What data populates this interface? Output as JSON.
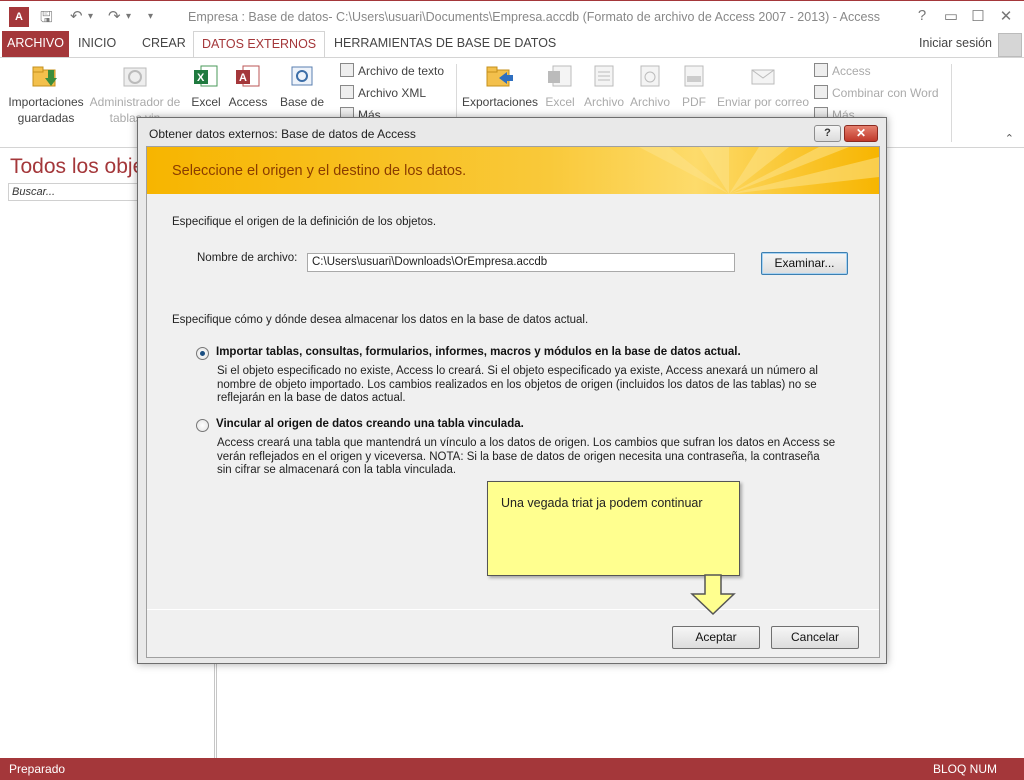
{
  "window": {
    "title": "Empresa : Base de datos- C:\\Users\\usuari\\Documents\\Empresa.accdb (Formato de archivo de Access 2007 - 2013) - Access",
    "app_icon_text": "A",
    "controls": {
      "help": "?",
      "minimize": "—",
      "maximize": "☐",
      "close": "✕"
    }
  },
  "quick_access": {
    "save": "🖫",
    "undo": "↶",
    "undo_drop": "▾",
    "redo": "↷",
    "redo_drop": "▾",
    "customize": "▾"
  },
  "tabs": [
    "ARCHIVO",
    "INICIO",
    "CREAR",
    "DATOS EXTERNOS",
    "HERRAMIENTAS DE BASE DE DATOS"
  ],
  "signin_label": "Iniciar sesión",
  "ribbon": {
    "import_group": {
      "saved_imports": [
        "Importaciones",
        "guardadas"
      ],
      "linked_table_manager": [
        "Administrador de",
        "tablas vin"
      ],
      "excel": "Excel",
      "access": "Access",
      "database": "Base de",
      "text_file": "Archivo de texto",
      "xml_file": "Archivo XML",
      "more": "Más"
    },
    "export_group": {
      "exports": "Exportaciones",
      "excel": "Excel",
      "file1": "Archivo",
      "file2": "Archivo",
      "pdf": "PDF",
      "email": "Enviar por correo",
      "access": "Access",
      "merge_word": "Combinar con Word",
      "more": "Más"
    },
    "collapse_icon": "⌃"
  },
  "nav_pane": {
    "title": "Todos los obje",
    "search_placeholder": "Buscar..."
  },
  "status_bar": {
    "left": "Preparado",
    "right": "BLOQ NUM"
  },
  "dialog": {
    "title": "Obtener datos externos: Base de datos de Access",
    "help_label": "?",
    "close_label": "✕",
    "banner": "Seleccione el origen y el destino de los datos.",
    "source_prompt": "Especifique el origen de la definición de los objetos.",
    "file_label": "Nombre de archivo:",
    "file_value": "C:\\Users\\usuari\\Downloads\\OrEmpresa.accdb",
    "browse_label": "Examinar...",
    "dest_prompt": "Especifique cómo y dónde desea almacenar los datos en la base de datos actual.",
    "options": [
      {
        "title": "Importar tablas, consultas, formularios, informes, macros y módulos en la base de datos actual.",
        "desc": "Si el objeto especificado no existe, Access lo creará. Si el objeto especificado ya existe, Access anexará un número al nombre de objeto importado. Los cambios realizados en los objetos de origen (incluidos los datos de las tablas) no se reflejarán en la base de datos actual.",
        "selected": true
      },
      {
        "title": "Vincular al origen de datos creando una tabla vinculada.",
        "desc": "Access creará una tabla que mantendrá un vínculo a los datos de origen. Los cambios que sufran los datos en Access se verán reflejados en el origen y viceversa. NOTA: Si la base de datos de origen necesita una contraseña, la contraseña sin cifrar se almacenará con la tabla vinculada.",
        "selected": false
      }
    ],
    "ok_label": "Aceptar",
    "cancel_label": "Cancelar"
  },
  "callout": {
    "text": "Una vegada triat ja podem continuar"
  },
  "colors": {
    "access_red": "#a4373a",
    "banner_yellow": "#f7b500",
    "callout_yellow": "#ffff8f"
  }
}
